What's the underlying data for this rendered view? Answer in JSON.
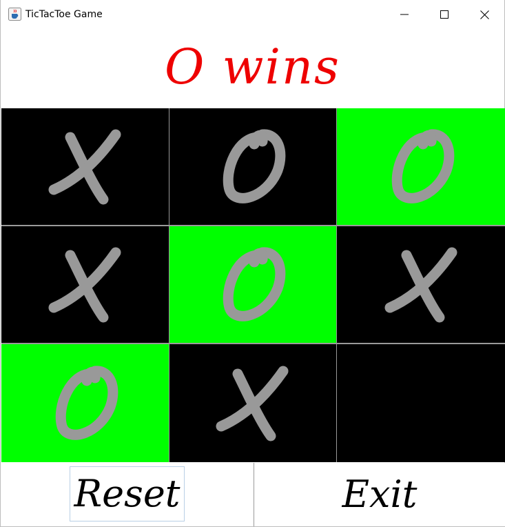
{
  "window": {
    "title": "TicTacToe Game",
    "icon": "java-cup-icon",
    "controls": [
      "minimize",
      "maximize",
      "close"
    ]
  },
  "status": {
    "text": "O wins",
    "color": "#ee0000"
  },
  "board": {
    "cells": [
      {
        "mark": "X",
        "winning": false
      },
      {
        "mark": "O",
        "winning": false
      },
      {
        "mark": "O",
        "winning": true
      },
      {
        "mark": "X",
        "winning": false
      },
      {
        "mark": "O",
        "winning": true
      },
      {
        "mark": "X",
        "winning": false
      },
      {
        "mark": "O",
        "winning": true
      },
      {
        "mark": "X",
        "winning": false
      },
      {
        "mark": "",
        "winning": false
      }
    ],
    "colors": {
      "cell": "#000000",
      "win": "#00ff00",
      "mark": "#999999"
    }
  },
  "buttons": {
    "reset_label": "Reset",
    "exit_label": "Exit"
  }
}
